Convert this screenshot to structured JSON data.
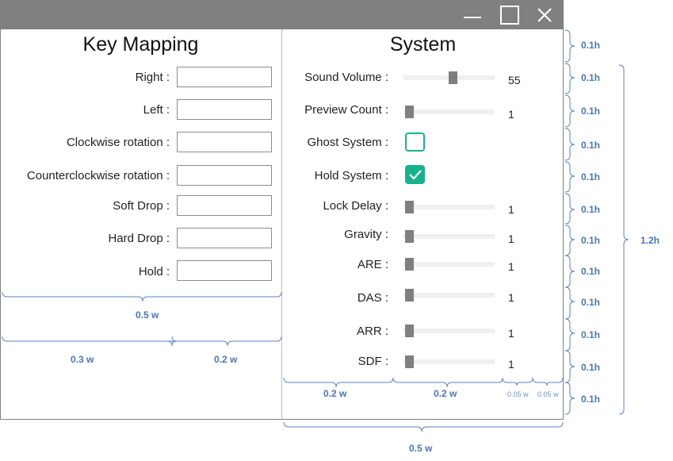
{
  "window": {
    "controls": {
      "minimize": "minimize",
      "maximize": "maximize",
      "close": "close"
    }
  },
  "key_mapping": {
    "title": "Key Mapping",
    "rows": [
      {
        "label": "Right :",
        "value": ""
      },
      {
        "label": "Left :",
        "value": ""
      },
      {
        "label": "Clockwise rotation :",
        "value": ""
      },
      {
        "label": "Counterclockwise rotation :",
        "value": ""
      },
      {
        "label": "Soft Drop :",
        "value": ""
      },
      {
        "label": "Hard Drop :",
        "value": ""
      },
      {
        "label": "Hold :",
        "value": ""
      }
    ]
  },
  "system": {
    "title": "System",
    "sound_volume": {
      "label": "Sound Volume :",
      "value": "55",
      "fraction": 0.55
    },
    "preview_count": {
      "label": "Preview Count :",
      "value": "1",
      "fraction": 0.02
    },
    "ghost_system": {
      "label": "Ghost System :",
      "checked": false
    },
    "hold_system": {
      "label": "Hold System :",
      "checked": true
    },
    "lock_delay": {
      "label": "Lock Delay :",
      "value": "1",
      "fraction": 0.02
    },
    "gravity": {
      "label": "Gravity :",
      "value": "1",
      "fraction": 0.02
    },
    "are": {
      "label": "ARE :",
      "value": "1",
      "fraction": 0.02
    },
    "das": {
      "label": "DAS :",
      "value": "1",
      "fraction": 0.02
    },
    "arr": {
      "label": "ARR :",
      "value": "1",
      "fraction": 0.02
    },
    "sdf": {
      "label": "SDF :",
      "value": "1",
      "fraction": 0.02
    }
  },
  "annotations": {
    "row_h": "0.1h",
    "total_h": "1.2h",
    "half_w": "0.5 w",
    "w03": "0.3 w",
    "w02": "0.2 w",
    "w005": "0.05",
    "w_unit": "w"
  },
  "colors": {
    "titlebar": "#808080",
    "accent": "#16b38a",
    "annotation": "#4a74b8"
  }
}
